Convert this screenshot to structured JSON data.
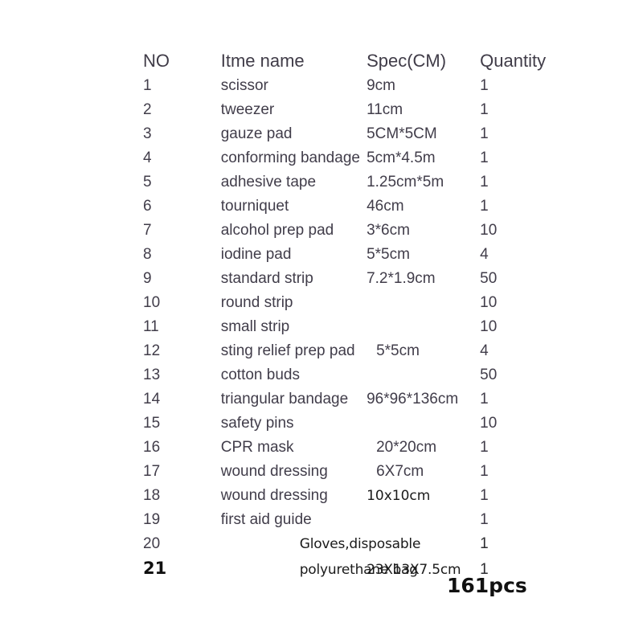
{
  "document": {
    "kind": "packing-list",
    "accent_alert_color": "#ef2626",
    "text_color": "#413d4a"
  },
  "table": {
    "headers": {
      "no": "NO",
      "name": "Itme name",
      "spec": "Spec(CM)",
      "quantity": "Quantity"
    },
    "rows": [
      {
        "no": "1",
        "name": "scissor",
        "spec": "9cm",
        "qty": "1"
      },
      {
        "no": "2",
        "name": "tweezer",
        "spec": "11cm",
        "qty": "1"
      },
      {
        "no": "3",
        "name": "gauze pad",
        "spec": "5CM*5CM",
        "qty": "1"
      },
      {
        "no": "4",
        "name": "conforming bandage",
        "spec": "5cm*4.5m",
        "qty": "1"
      },
      {
        "no": "5",
        "name": "adhesive tape",
        "spec": "1.25cm*5m",
        "qty": "1"
      },
      {
        "no": "6",
        "name": "tourniquet",
        "spec": "46cm",
        "qty": "1"
      },
      {
        "no": "7",
        "name": "alcohol prep pad",
        "spec": "3*6cm",
        "qty": "10"
      },
      {
        "no": "8",
        "name": "iodine pad",
        "spec": "5*5cm",
        "qty": "4"
      },
      {
        "no": "9",
        "name": "standard strip",
        "spec": "7.2*1.9cm",
        "qty": "50"
      },
      {
        "no": "10",
        "name": "round strip",
        "spec": "",
        "qty": "10"
      },
      {
        "no": "11",
        "name": "small strip",
        "spec": "",
        "qty": "10"
      },
      {
        "no": "12",
        "name": "sting relief prep pad",
        "spec": "5*5cm",
        "qty": "4"
      },
      {
        "no": "13",
        "name": "cotton buds",
        "spec": "",
        "qty": "50"
      },
      {
        "no": "14",
        "name": "triangular bandage",
        "spec": "96*96*136cm",
        "qty": "1"
      },
      {
        "no": "15",
        "name": "safety pins",
        "spec": "",
        "qty": "10"
      },
      {
        "no": "16",
        "name": "CPR mask",
        "spec": "20*20cm",
        "qty": "1"
      },
      {
        "no": "17",
        "name": "wound dressing",
        "spec": "6X7cm",
        "qty": "1"
      },
      {
        "no": "18",
        "name": "wound dressing",
        "spec": "10x10cm",
        "qty": "1"
      },
      {
        "no": "19",
        "name": "first aid guide",
        "spec": "",
        "qty": "1"
      },
      {
        "no": "20",
        "name": "Gloves,disposable",
        "spec": "",
        "qty": "1"
      },
      {
        "no": "21",
        "name": "polyurethane bag",
        "spec": "23X13X7.5cm",
        "qty": "1"
      }
    ]
  },
  "total": {
    "label": "161pcs"
  }
}
